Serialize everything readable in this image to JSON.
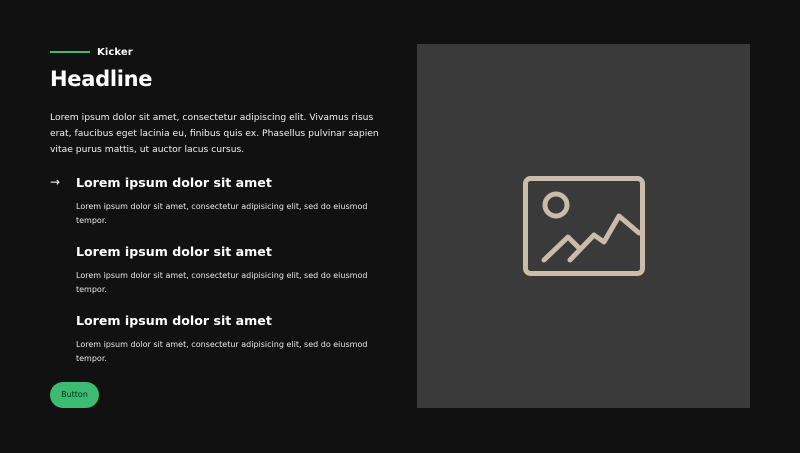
{
  "kicker": "Kicker",
  "headline": "Headline",
  "intro": "Lorem ipsum dolor sit amet, consectetur adipiscing elit. Vivamus risus erat, faucibus eget lacinia eu, finibus quis ex. Phasellus pulvinar sapien vitae purus mattis, ut auctor lacus cursus.",
  "features": [
    {
      "title": "Lorem ipsum dolor sit amet",
      "body": "Lorem ipsum dolor sit amet, consectetur adipisicing elit, sed do eiusmod tempor.",
      "icon": "arrow-right-icon"
    },
    {
      "title": "Lorem ipsum dolor sit amet",
      "body": "Lorem ipsum dolor sit amet, consectetur adipisicing elit, sed do eiusmod tempor."
    },
    {
      "title": "Lorem ipsum dolor sit amet",
      "body": "Lorem ipsum dolor sit amet, consectetur adipisicing elit, sed do eiusmod tempor."
    }
  ],
  "button": {
    "label": "Button"
  },
  "media": {
    "icon": "image-placeholder-icon"
  },
  "colors": {
    "background": "#111111",
    "accent": "#3dbb73",
    "media_background": "#3a3a3a",
    "icon": "#c9bda9"
  }
}
